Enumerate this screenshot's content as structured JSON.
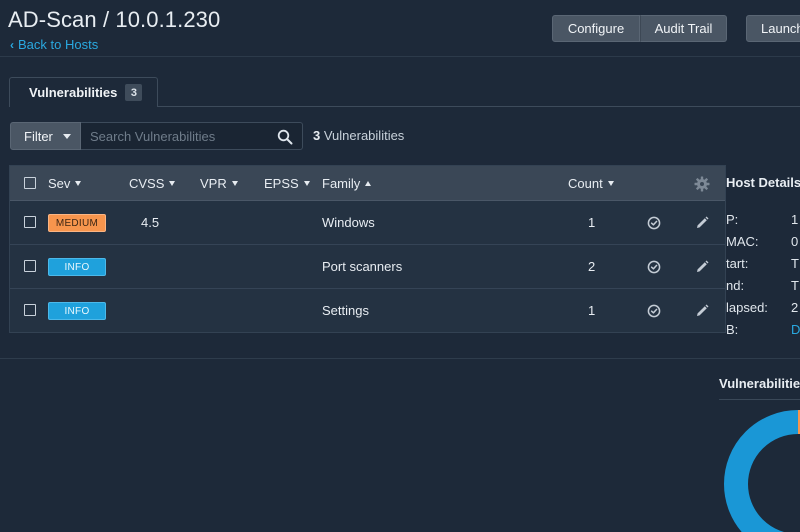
{
  "header": {
    "title": "AD-Scan / 10.0.1.230",
    "back_label": "Back to Hosts",
    "buttons": {
      "configure": "Configure",
      "audit_trail": "Audit Trail",
      "launch": "Launch"
    }
  },
  "tabs": [
    {
      "label": "Vulnerabilities",
      "count": "3"
    }
  ],
  "toolbar": {
    "filter_label": "Filter",
    "search_placeholder": "Search Vulnerabilities",
    "result_count": "3",
    "result_label": "Vulnerabilities"
  },
  "table": {
    "columns": {
      "sev": "Sev",
      "cvss": "CVSS",
      "vpr": "VPR",
      "epss": "EPSS",
      "family": "Family",
      "count": "Count"
    },
    "rows": [
      {
        "severity": "MEDIUM",
        "cvss": "4.5",
        "vpr": "",
        "epss": "",
        "family": "Windows",
        "count": "1"
      },
      {
        "severity": "INFO",
        "cvss": "",
        "vpr": "",
        "epss": "",
        "family": "Port scanners",
        "count": "2"
      },
      {
        "severity": "INFO",
        "cvss": "",
        "vpr": "",
        "epss": "",
        "family": "Settings",
        "count": "1"
      }
    ]
  },
  "host_details": {
    "title": "Host Details",
    "fields": [
      {
        "label": "P:",
        "value": "1"
      },
      {
        "label": "MAC:",
        "value": "0"
      },
      {
        "label": "tart:",
        "value": "T"
      },
      {
        "label": "nd:",
        "value": "T"
      },
      {
        "label": "lapsed:",
        "value": "2"
      },
      {
        "label": "B:",
        "value": "D"
      }
    ]
  },
  "vulnerabilities_panel": {
    "title": "Vulnerabilities"
  },
  "colors": {
    "background": "#1d2939",
    "accent_link": "#2aa9e0",
    "medium": "#f7954d",
    "info": "#1fa1dc"
  }
}
